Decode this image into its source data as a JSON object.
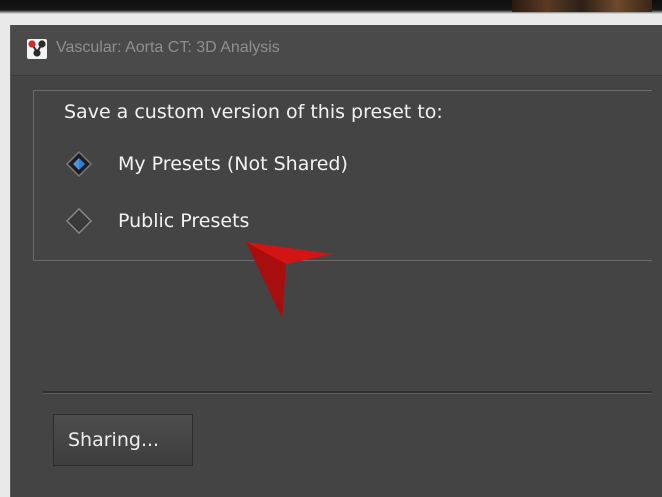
{
  "window": {
    "title": "Vascular: Aorta CT: 3D Analysis",
    "app_icon": "molecule-icon"
  },
  "save_group": {
    "legend": "Save a custom version of this preset to:",
    "options": [
      {
        "label": "My Presets (Not Shared)",
        "selected": true
      },
      {
        "label": "Public Presets",
        "selected": false
      }
    ]
  },
  "footer": {
    "sharing_label": "Sharing..."
  },
  "annotation": {
    "icon": "red-arrow-pointer-icon",
    "color": "#d21414"
  },
  "colors": {
    "window_bg": "#444444",
    "text": "#f2f2f2",
    "title_text": "#8f8f8f",
    "radio_selected": "#2f7fd6"
  }
}
